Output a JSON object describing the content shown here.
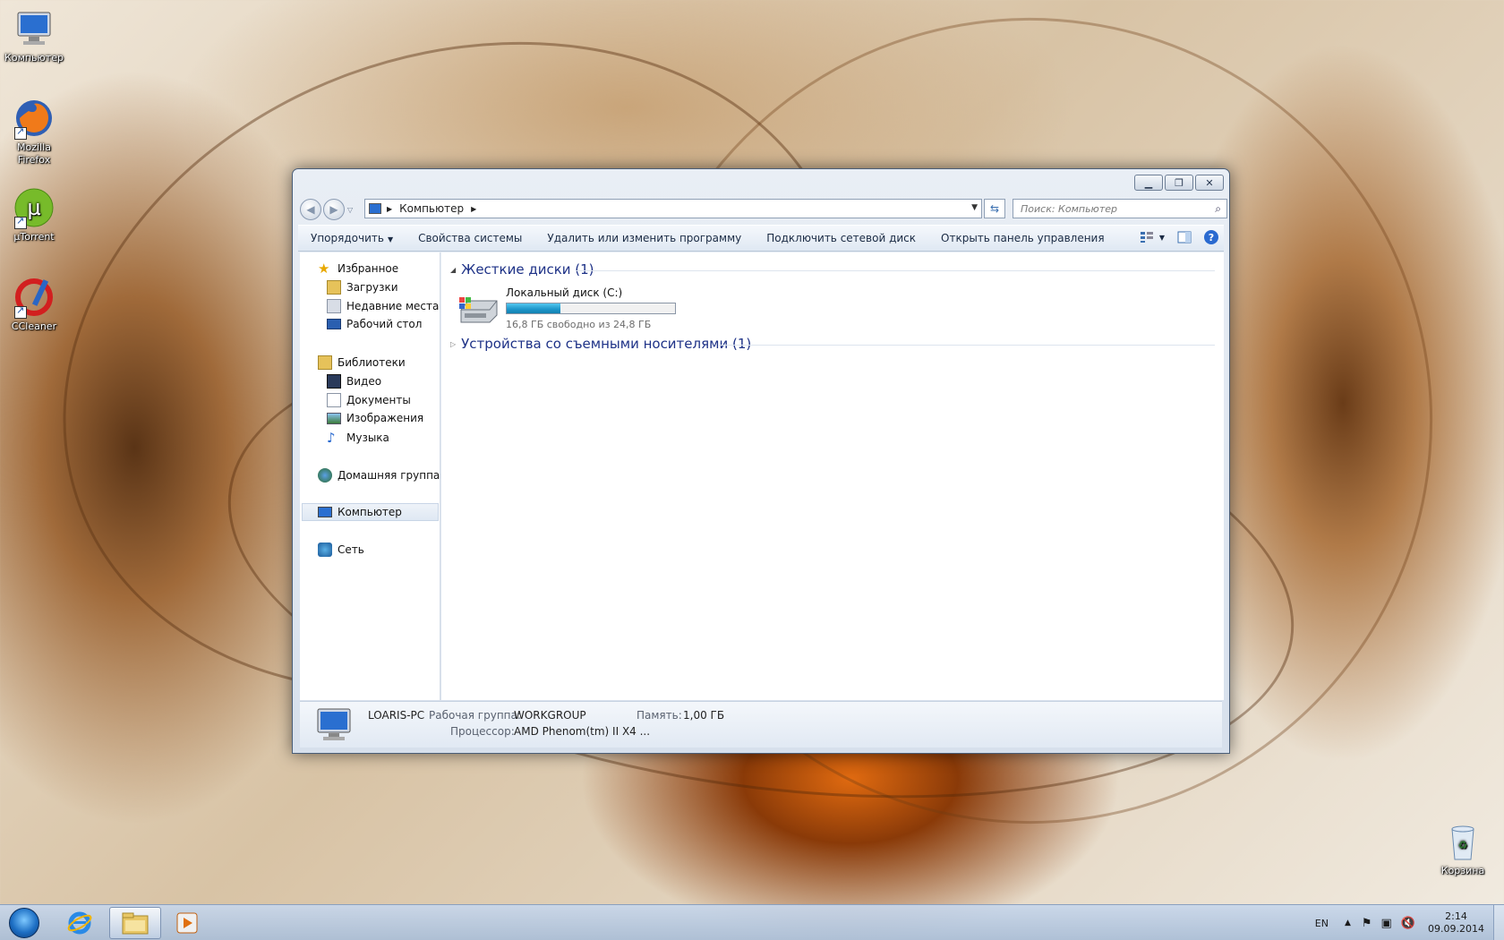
{
  "desktop": {
    "icons": [
      {
        "label": "Компьютер",
        "icon": "computer-icon"
      },
      {
        "label": "Mozilla Firefox",
        "icon": "firefox-icon"
      },
      {
        "label": "µTorrent",
        "icon": "utorrent-icon"
      },
      {
        "label": "CCleaner",
        "icon": "ccleaner-icon"
      },
      {
        "label": "Корзина",
        "icon": "recycle-bin-icon"
      }
    ]
  },
  "window": {
    "buttons": {
      "minimize": "▁",
      "restore": "❐",
      "close": "✕"
    },
    "address": {
      "segment": "Компьютер"
    },
    "search": {
      "placeholder": "Поиск: Компьютер"
    },
    "command_bar": {
      "organize": "Упорядочить",
      "system_properties": "Свойства системы",
      "uninstall": "Удалить или изменить программу",
      "map_drive": "Подключить сетевой диск",
      "control_panel": "Открыть панель управления"
    },
    "nav": {
      "favorites": "Избранное",
      "downloads": "Загрузки",
      "recent": "Недавние места",
      "desktop": "Рабочий стол",
      "libraries": "Библиотеки",
      "video": "Видео",
      "documents": "Документы",
      "pictures": "Изображения",
      "music": "Музыка",
      "homegroup": "Домашняя группа",
      "computer": "Компьютер",
      "network": "Сеть"
    },
    "content": {
      "hdd_group": "Жесткие диски (1)",
      "drive_name": "Локальный диск (C:)",
      "drive_used_fraction": 0.32,
      "drive_free": "16,8 ГБ свободно из 24,8 ГБ",
      "removable_group": "Устройства со съемными носителями (1)"
    },
    "details": {
      "pc_name": "LOARIS-PC",
      "workgroup_label": "Рабочая группа:",
      "workgroup_value": "WORKGROUP",
      "memory_label": "Память:",
      "memory_value": "1,00 ГБ",
      "cpu_label": "Процессор:",
      "cpu_value": "AMD Phenom(tm) II X4 ..."
    }
  },
  "taskbar": {
    "lang": "EN",
    "time": "2:14",
    "date": "09.09.2014"
  }
}
